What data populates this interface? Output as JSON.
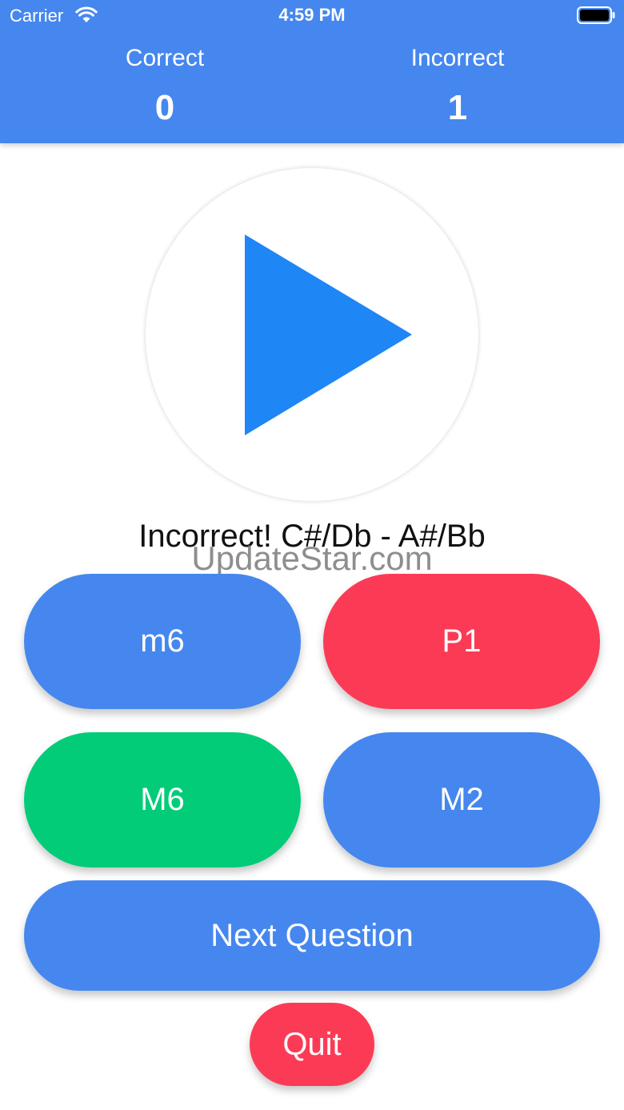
{
  "status_bar": {
    "carrier": "Carrier",
    "time": "4:59 PM"
  },
  "scoreboard": {
    "correct_label": "Correct",
    "correct_value": "0",
    "incorrect_label": "Incorrect",
    "incorrect_value": "1"
  },
  "play_button": {
    "icon": "play-icon",
    "color": "#1f86f5"
  },
  "feedback": {
    "text": "Incorrect! C#/Db - A#/Bb"
  },
  "watermark": {
    "text": "UpdateStar.com"
  },
  "answers": [
    {
      "label": "m6",
      "state": "default",
      "color": "#4587ee"
    },
    {
      "label": "P1",
      "state": "wrong",
      "color": "#fb3b55"
    },
    {
      "label": "M6",
      "state": "correct",
      "color": "#02cc78"
    },
    {
      "label": "M2",
      "state": "default",
      "color": "#4587ee"
    }
  ],
  "actions": {
    "next_label": "Next Question",
    "quit_label": "Quit"
  },
  "colors": {
    "header": "#4587ee",
    "red": "#fb3b55",
    "green": "#02cc78",
    "blue": "#4587ee"
  }
}
